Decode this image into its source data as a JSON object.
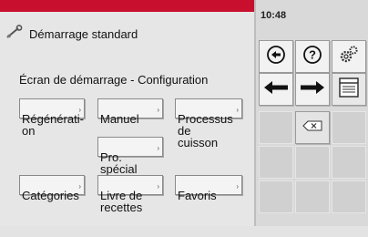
{
  "header": {
    "title": "Démarrage standard",
    "time": "10:48"
  },
  "screen": {
    "subtitle": "Écran de démarrage - Configuration"
  },
  "buttons": {
    "regeneration": "Régénérati-\non",
    "manuel": "Manuel",
    "processus": "Processus\nde cuisson",
    "pro_special": "Pro.\nspécial",
    "categories": "Catégories",
    "livre": "Livre de\nrecettes",
    "favoris": "Favoris"
  },
  "icons": {
    "title": "tools-icon",
    "back": "back-circle-icon",
    "help": "help-icon",
    "settings": "gears-icon",
    "left": "arrow-left-icon",
    "right": "arrow-right-icon",
    "window": "window-icon",
    "delete": "backspace-icon"
  },
  "colors": {
    "topbar": "#c8102e"
  }
}
